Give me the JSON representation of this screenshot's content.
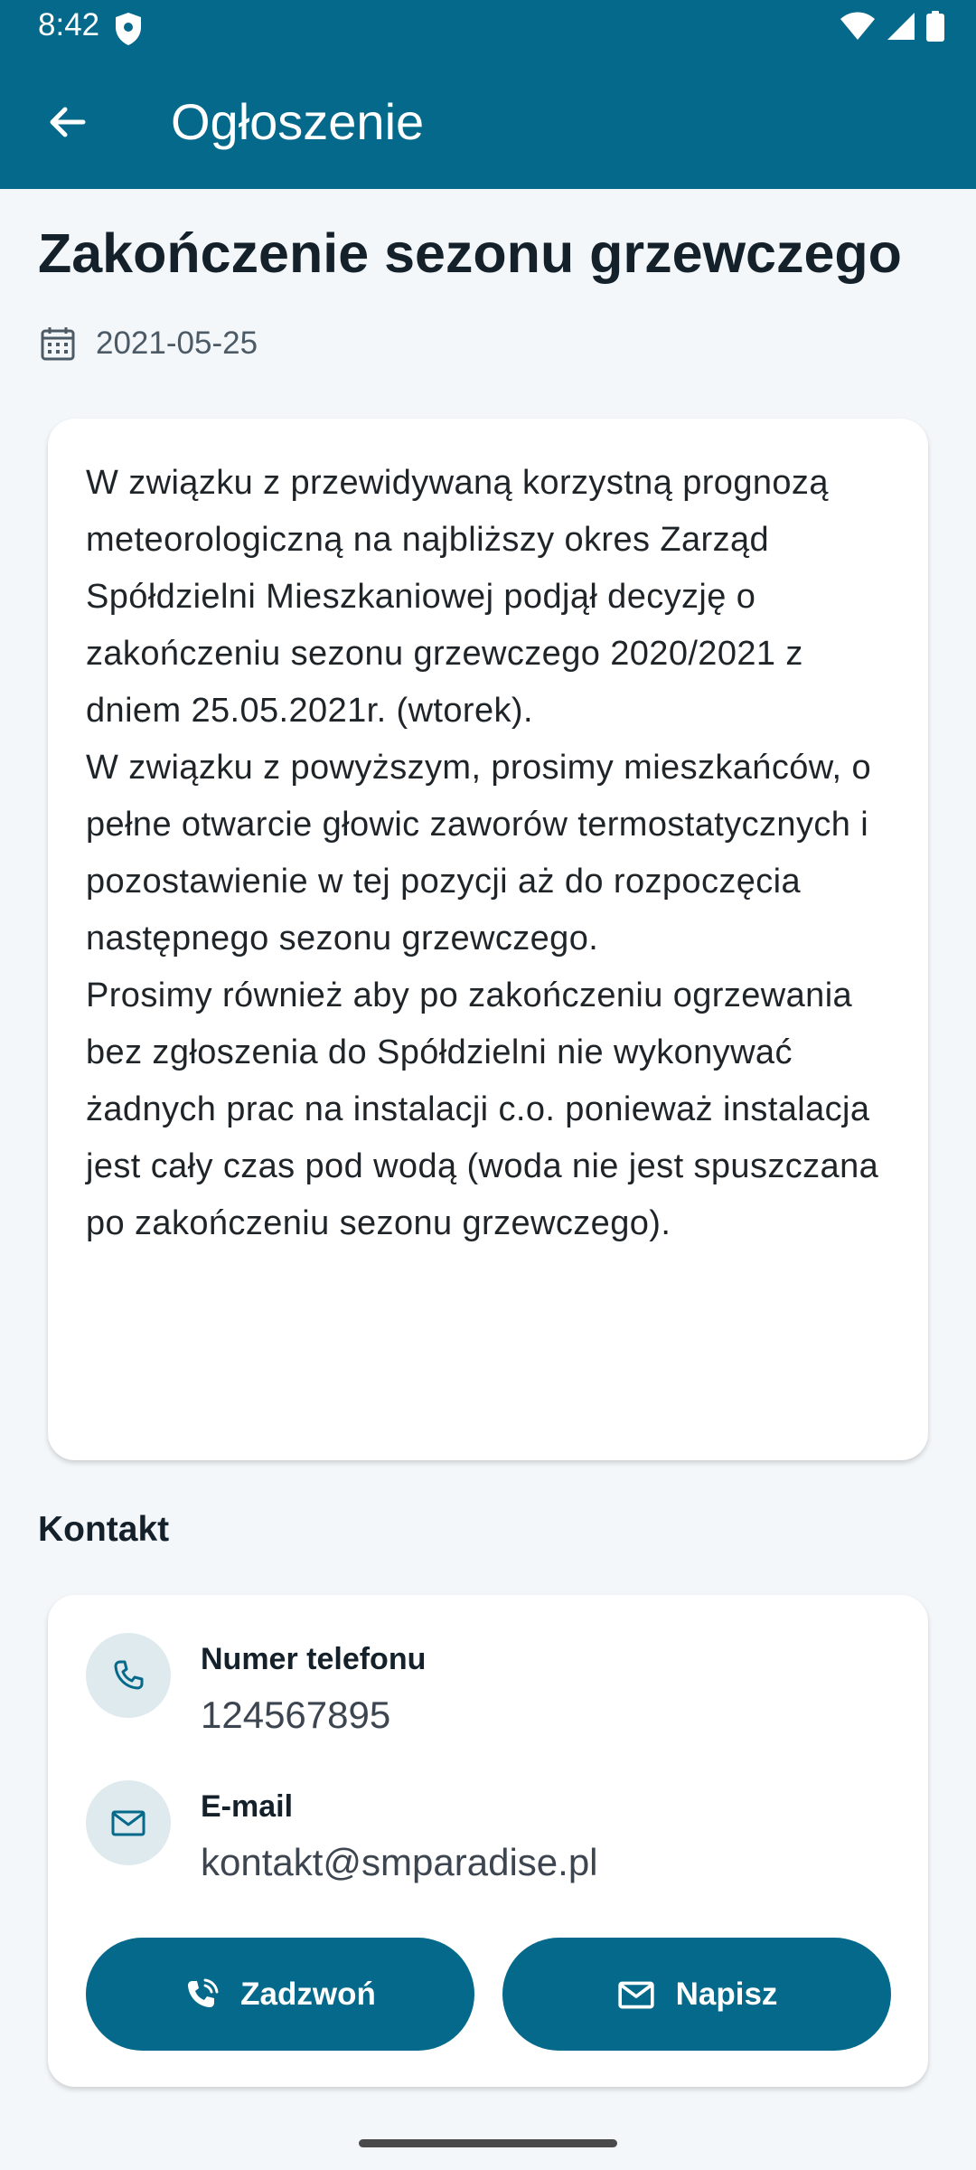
{
  "status_bar": {
    "time": "8:42"
  },
  "app_bar": {
    "title": "Ogłoszenie"
  },
  "announcement": {
    "title": "Zakończenie sezonu grzewczego",
    "date": "2021-05-25",
    "paragraphs": [
      "W związku z przewidywaną korzystną prognozą meteorologiczną na najbliższy okres Zarząd Spółdzielni Mieszkaniowej podjął decyzję o zakończeniu sezonu grzewczego 2020/2021  z dniem 25.05.2021r. (wtorek).",
      "W związku z powyższym, prosimy mieszkańców, o pełne otwarcie głowic zaworów termostatycznych i pozostawienie w tej pozycji aż do rozpoczęcia następnego sezonu grzewczego.",
      "Prosimy również aby po zakończeniu ogrzewania bez zgłoszenia do Spółdzielni nie wykonywać żadnych prac na instalacji c.o. ponieważ instalacja jest cały czas pod wodą (woda nie jest spuszczana po zakończeniu sezonu grzewczego)."
    ]
  },
  "contact": {
    "heading": "Kontakt",
    "phone_label": "Numer telefonu",
    "phone_value": "124567895",
    "email_label": "E-mail",
    "email_value": "kontakt@smparadise.pl",
    "call_button": "Zadzwoń",
    "write_button": "Napisz"
  },
  "icons": {
    "back": "arrow-back-icon",
    "date": "calendar-icon",
    "phone": "phone-icon",
    "email": "mail-icon",
    "call": "phone-in-talk-icon"
  },
  "colors": {
    "primary": "#04698a",
    "background": "#f3f7fa",
    "icon_circle": "#dfeaee"
  }
}
